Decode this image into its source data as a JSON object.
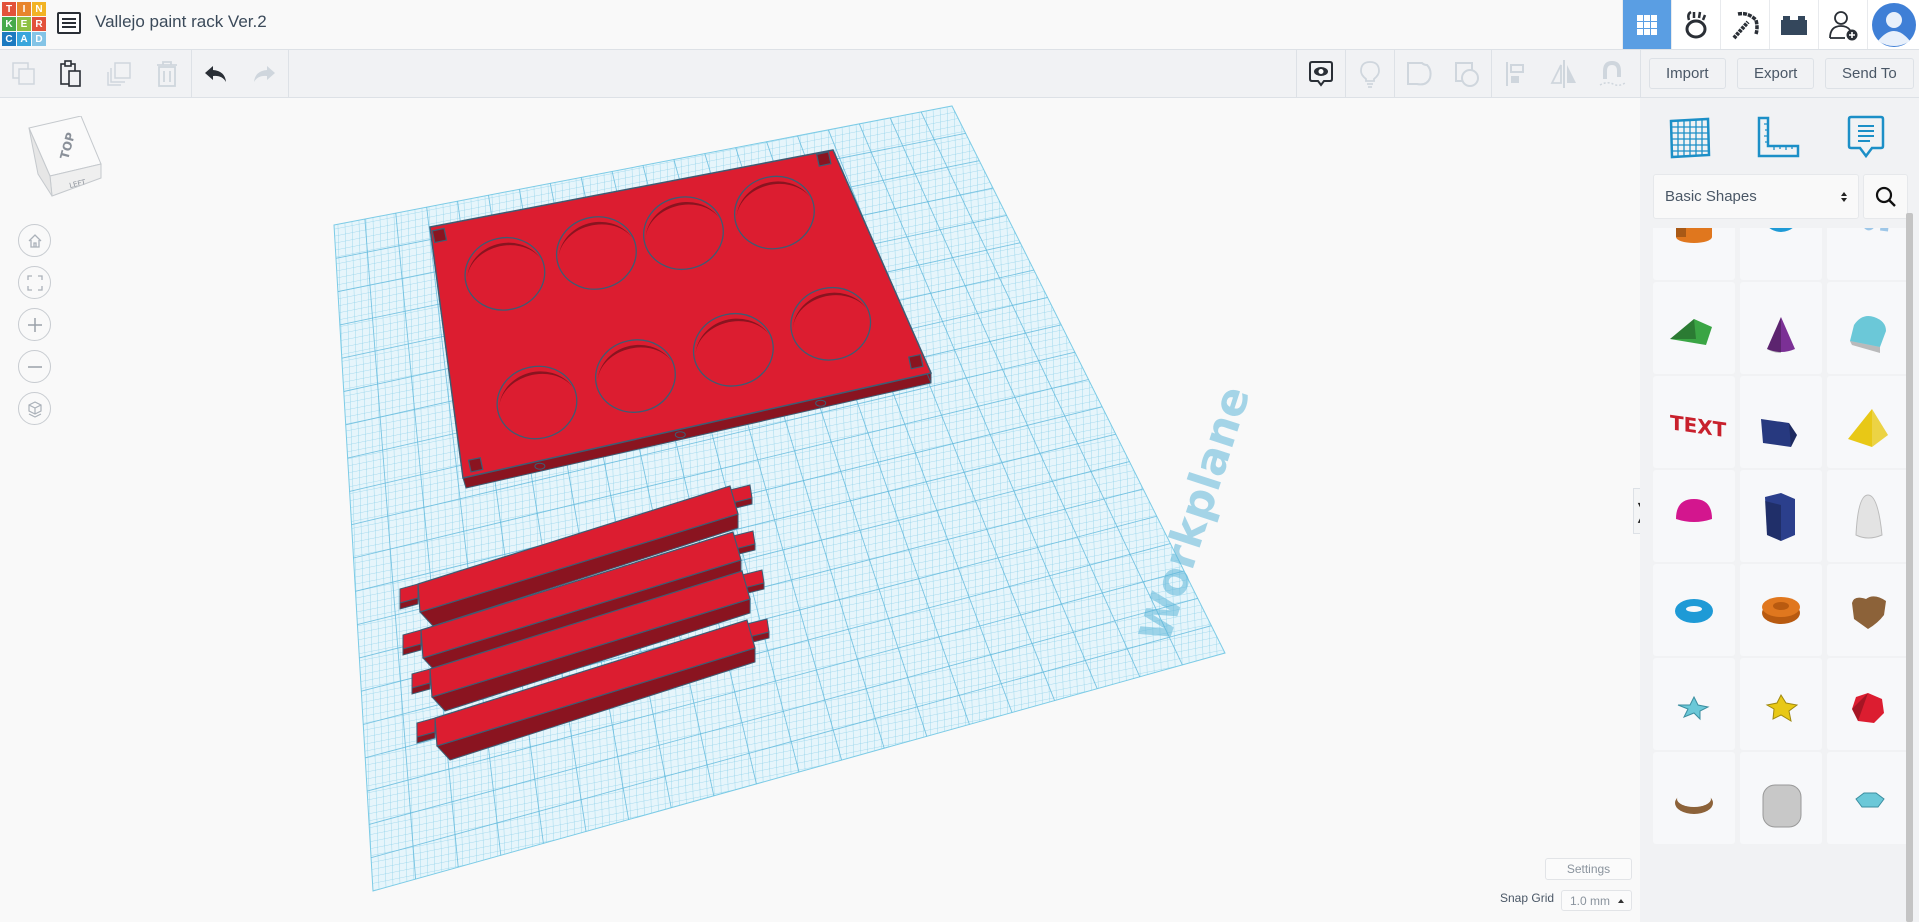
{
  "app": {
    "logo_letters": [
      "T",
      "I",
      "N",
      "K",
      "E",
      "R",
      "C",
      "A",
      "D"
    ],
    "logo_colors": [
      "#e2513a",
      "#e8842b",
      "#f2b324",
      "#46a94a",
      "#8ec043",
      "#e2513a",
      "#1b7ac0",
      "#39a6dc",
      "#84c4e6"
    ],
    "title": "Vallejo paint rack Ver.2"
  },
  "header_icons": [
    {
      "name": "3d-design-view-icon",
      "active": true
    },
    {
      "name": "sim-lab-icon",
      "active": false
    },
    {
      "name": "minecraft-pickaxe-icon",
      "active": false
    },
    {
      "name": "bricks-icon",
      "active": false
    },
    {
      "name": "add-user-icon",
      "active": false
    },
    {
      "name": "user-avatar-icon",
      "active": false
    }
  ],
  "toolbar": {
    "left": [
      "copy",
      "paste",
      "duplicate",
      "delete",
      "undo",
      "redo"
    ],
    "right": [
      "show-notes",
      "light",
      "group",
      "ungroup",
      "align",
      "mirror",
      "cruise"
    ],
    "import_label": "Import",
    "export_label": "Export",
    "send_to_label": "Send To"
  },
  "view_cube": {
    "top_label": "TOP",
    "left_label": "LEFT"
  },
  "nav_controls": [
    "home-view",
    "fit-view",
    "zoom-in",
    "zoom-out",
    "ortho-toggle"
  ],
  "workplane": {
    "label": "Workplane"
  },
  "scene": {
    "colors": {
      "top": "#dc1d30",
      "side": "#8a1420",
      "outline": "#3e5c73",
      "grid": "#7ccbe6",
      "plane": "#d6eef8"
    },
    "tray_holes": 8,
    "bars": 4
  },
  "panel": {
    "tools": [
      "workplane-grid-icon",
      "ruler-icon",
      "notes-icon"
    ],
    "category": "Basic Shapes",
    "shapes": [
      {
        "name": "cylinder",
        "color": "#e0771e"
      },
      {
        "name": "sphere",
        "color": "#1e9ad6"
      },
      {
        "name": "scribble",
        "color": "#9ec7e8"
      },
      {
        "name": "roof",
        "color": "#3aa544"
      },
      {
        "name": "cone",
        "color": "#7b3095"
      },
      {
        "name": "round-roof",
        "color": "#6bc8d8"
      },
      {
        "name": "text",
        "color": "#c8202c"
      },
      {
        "name": "wedge",
        "color": "#27397f"
      },
      {
        "name": "pyramid",
        "color": "#e8c816"
      },
      {
        "name": "half-sphere",
        "color": "#d3168e"
      },
      {
        "name": "polygon",
        "color": "#2b3f8c"
      },
      {
        "name": "paraboloid",
        "color": "#e3e3e3"
      },
      {
        "name": "torus",
        "color": "#1e9ad6"
      },
      {
        "name": "tube",
        "color": "#e0771e"
      },
      {
        "name": "heart",
        "color": "#8c6239"
      },
      {
        "name": "star",
        "color": "#6bc8d8"
      },
      {
        "name": "star-solid",
        "color": "#e8c816"
      },
      {
        "name": "icosahedron",
        "color": "#dc1d30"
      },
      {
        "name": "ring",
        "color": "#8c6239"
      },
      {
        "name": "rounded-box",
        "color": "#c8c8c8"
      },
      {
        "name": "diamond",
        "color": "#6bc8d8"
      }
    ]
  },
  "bottom": {
    "settings_label": "Settings",
    "snap_grid_label": "Snap Grid",
    "snap_grid_value": "1.0 mm"
  }
}
